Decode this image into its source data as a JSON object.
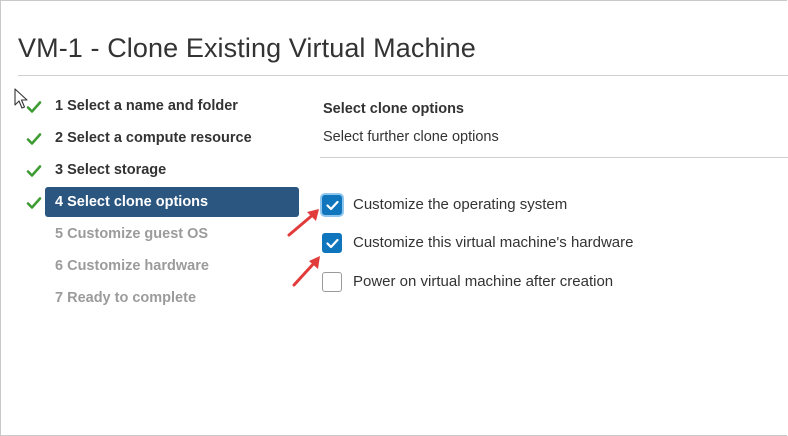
{
  "dialog": {
    "title": "VM-1 - Clone Existing Virtual Machine"
  },
  "steps": [
    {
      "label": "1 Select a name and folder",
      "status": "done"
    },
    {
      "label": "2 Select a compute resource",
      "status": "done"
    },
    {
      "label": "3 Select storage",
      "status": "done"
    },
    {
      "label": "4 Select clone options",
      "status": "active"
    },
    {
      "label": "5 Customize guest OS",
      "status": "pending"
    },
    {
      "label": "6 Customize hardware",
      "status": "pending"
    },
    {
      "label": "7 Ready to complete",
      "status": "pending"
    }
  ],
  "content": {
    "section_title": "Select clone options",
    "section_subtitle": "Select further clone options",
    "options": [
      {
        "label": "Customize the operating system",
        "checked": true
      },
      {
        "label": "Customize this virtual machine's hardware",
        "checked": true
      },
      {
        "label": "Power on virtual machine after creation",
        "checked": false
      }
    ]
  },
  "colors": {
    "active_step_bg": "#2b5680",
    "check_green": "#3f9c35",
    "checkbox_blue": "#0f75bd",
    "annotation_arrow": "#e23b3b"
  },
  "icons": [
    "check-icon",
    "mouse-cursor-icon",
    "annotation-arrow-icon"
  ]
}
